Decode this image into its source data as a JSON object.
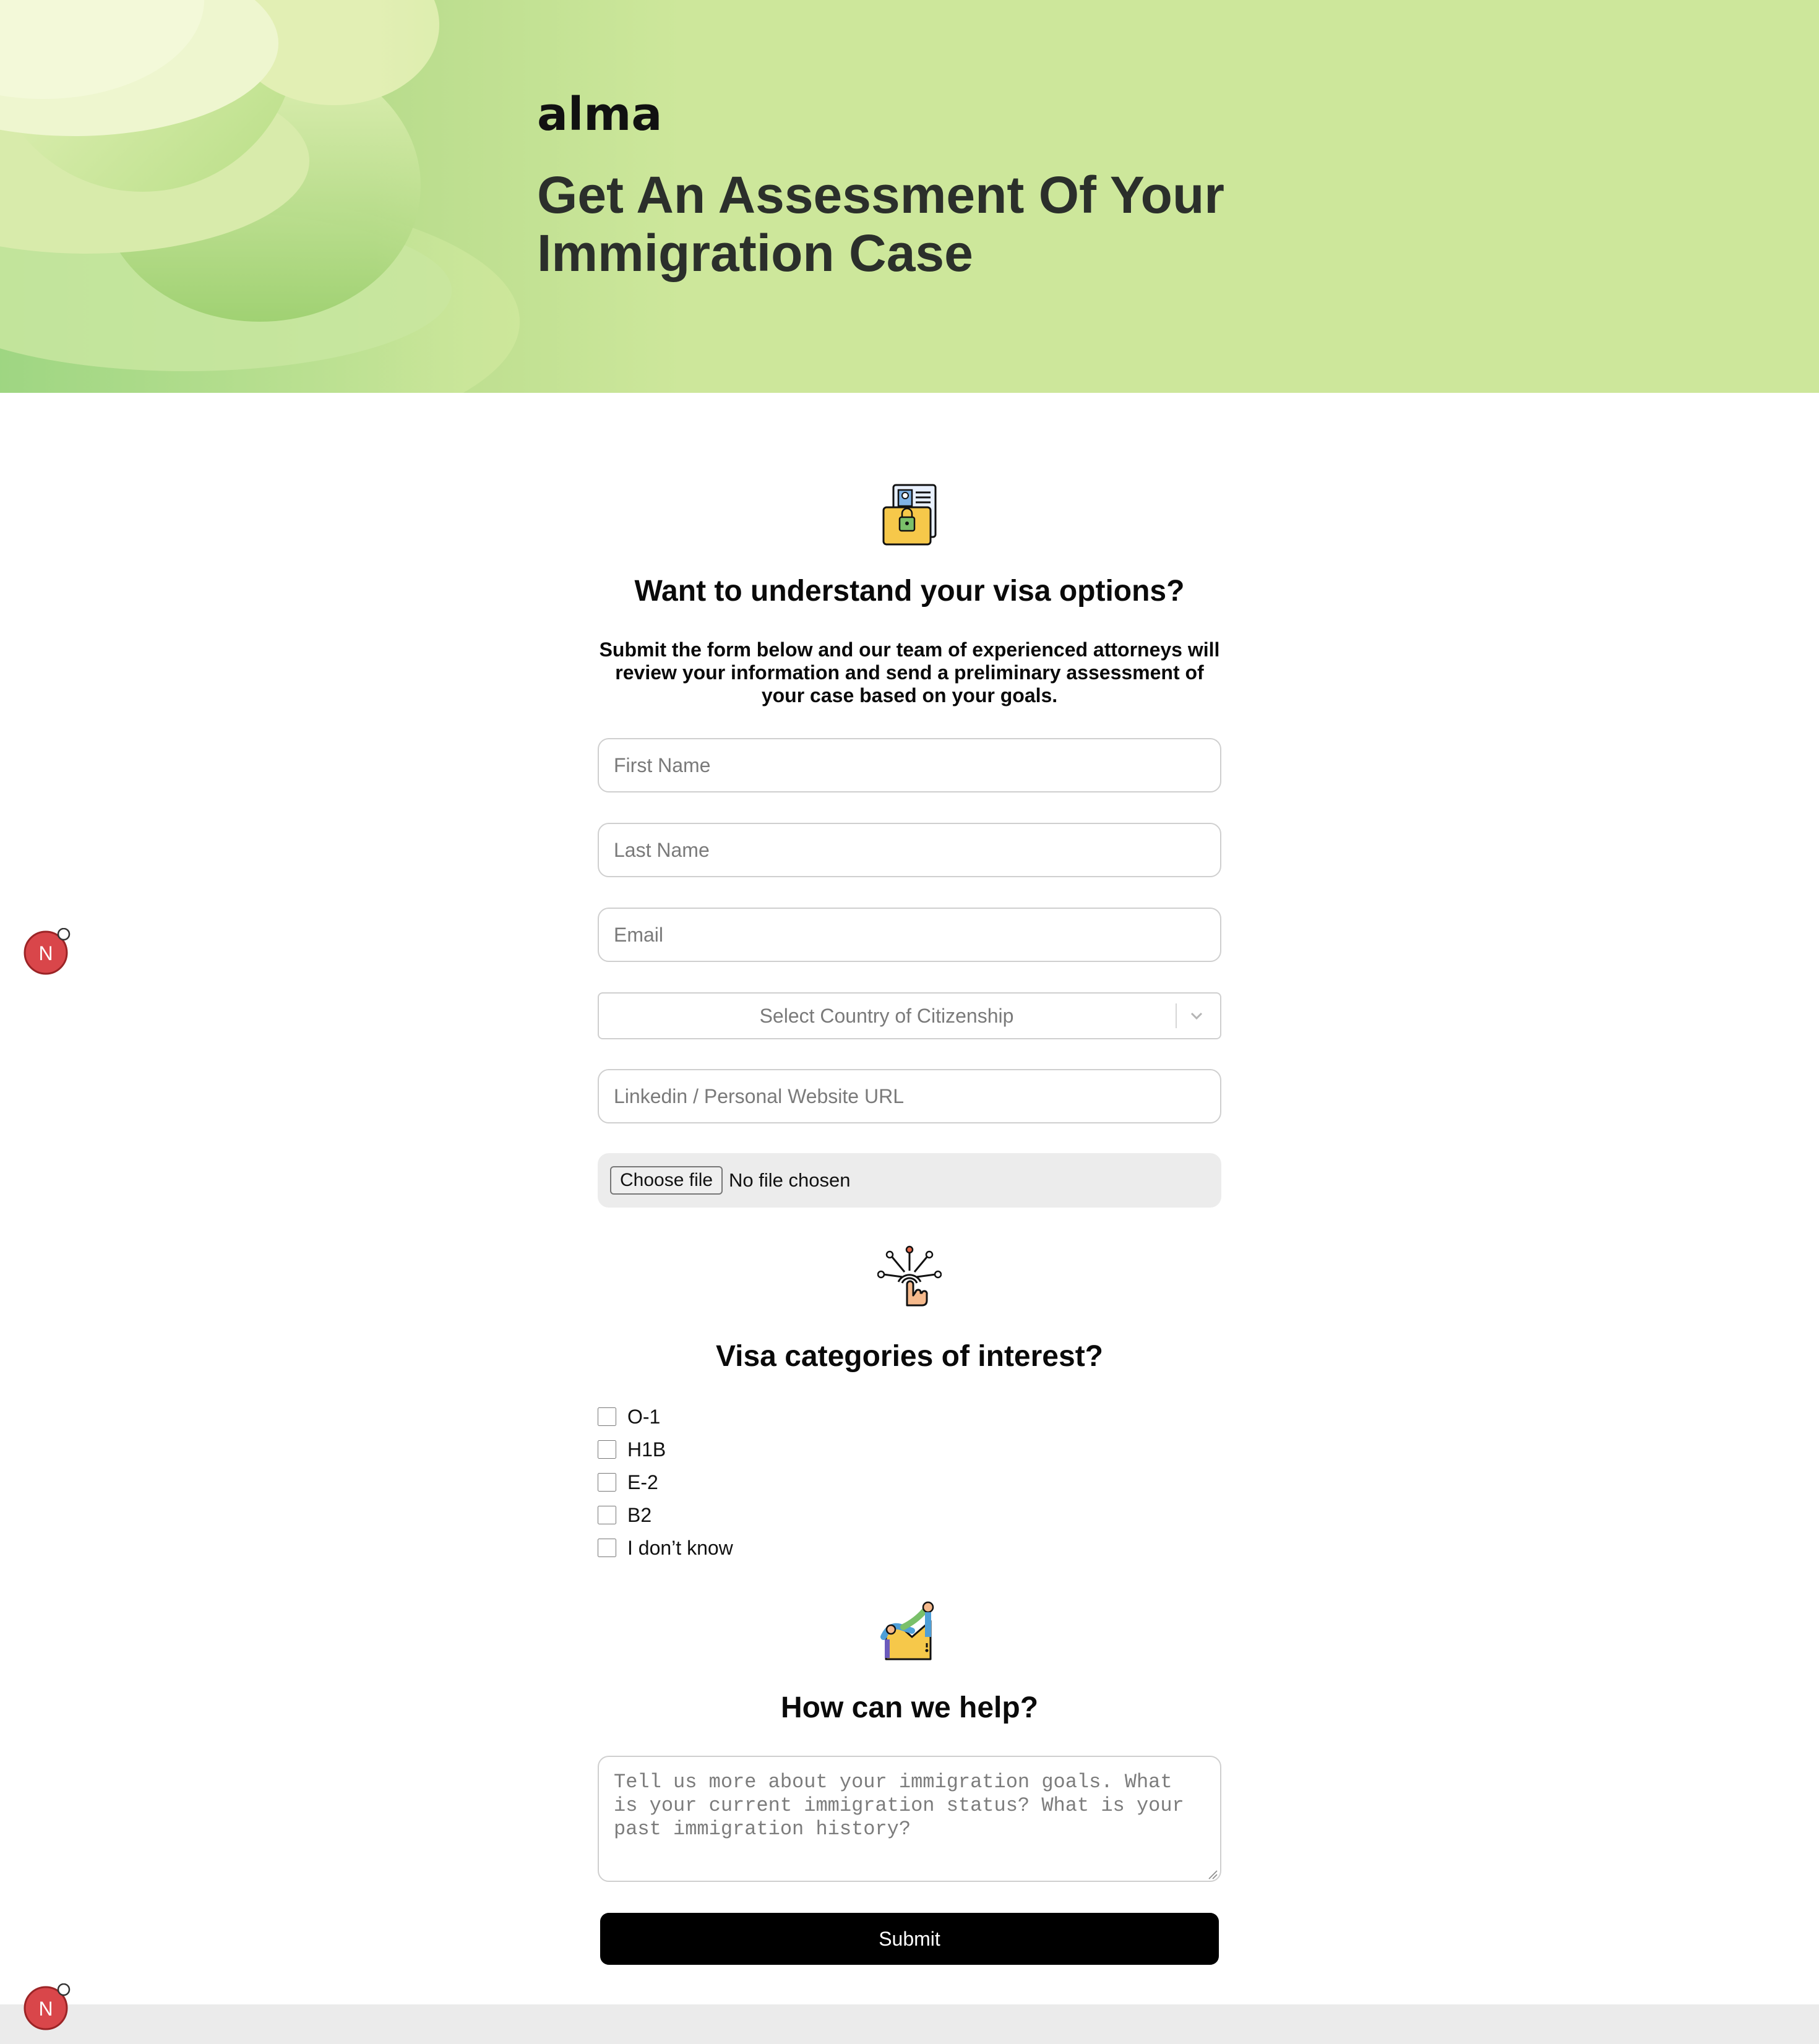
{
  "colors": {
    "hero_bg": "#cde79b",
    "heading_text": "#2b2f2b",
    "submit_bg": "#000000",
    "badge": "#d9464a"
  },
  "hero": {
    "logo_text": "alma",
    "title_line1": "Get An Assessment Of Your",
    "title_line2": "Immigration Case"
  },
  "form": {
    "icon_top": "passport-lock-icon",
    "heading": "Want to understand your visa options?",
    "intro": "Submit the form below and our team of experienced attorneys will review your information and send a preliminary assessment of your case based on your goals.",
    "first_name": {
      "placeholder": "First Name",
      "value": ""
    },
    "last_name": {
      "placeholder": "Last Name",
      "value": ""
    },
    "email": {
      "placeholder": "Email",
      "value": ""
    },
    "country": {
      "placeholder": "Select Country of Citizenship"
    },
    "website": {
      "placeholder": "Linkedin / Personal Website URL",
      "value": ""
    },
    "file": {
      "button": "Choose file",
      "status": "No file chosen"
    }
  },
  "visa": {
    "icon": "touch-network-icon",
    "heading": "Visa categories of interest?",
    "options": [
      {
        "label": "O-1",
        "checked": false
      },
      {
        "label": "H1B",
        "checked": false
      },
      {
        "label": "E-2",
        "checked": false
      },
      {
        "label": "B2",
        "checked": false
      },
      {
        "label": "I don’t know",
        "checked": false
      }
    ]
  },
  "help": {
    "icon": "helping-hand-climb-icon",
    "heading": "How can we help?",
    "placeholder": "Tell us more about your immigration goals. What is your current immigration status? What is your past immigration history?"
  },
  "submit_label": "Submit",
  "badges": [
    {
      "letter": "N",
      "icon": "dev-indicator-badge"
    },
    {
      "letter": "N",
      "icon": "dev-indicator-badge"
    }
  ]
}
